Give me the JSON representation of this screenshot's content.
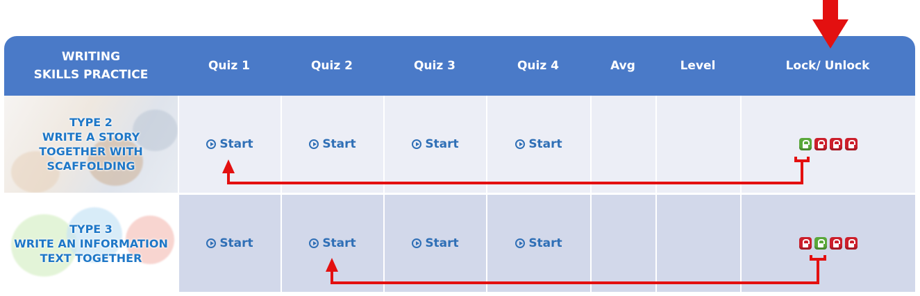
{
  "header": {
    "title_line1": "WRITING",
    "title_line2": "SKILLS PRACTICE",
    "quiz1": "Quiz 1",
    "quiz2": "Quiz 2",
    "quiz3": "Quiz 3",
    "quiz4": "Quiz 4",
    "avg": "Avg",
    "level": "Level",
    "lock_unlock": "Lock/ Unlock"
  },
  "rows": [
    {
      "title_lines": [
        "TYPE 2",
        "WRITE A STORY",
        "TOGETHER WITH",
        "SCAFFOLDING"
      ],
      "quizzes": [
        "Start",
        "Start",
        "Start",
        "Start"
      ],
      "avg": "",
      "level": "",
      "locks": [
        "unlocked",
        "locked",
        "locked",
        "locked"
      ]
    },
    {
      "title_lines": [
        "TYPE 3",
        "WRITE AN INFORMATION",
        "TEXT TOGETHER"
      ],
      "quizzes": [
        "Start",
        "Start",
        "Start",
        "Start"
      ],
      "avg": "",
      "level": "",
      "locks": [
        "locked",
        "unlocked",
        "locked",
        "locked"
      ]
    }
  ],
  "colors": {
    "header": "#4a7ac8",
    "row1": "#eceef6",
    "row2": "#d2d8ea",
    "link": "#2f6fb6",
    "title": "#1e77c7",
    "lock_red": "#cc1f2b",
    "lock_green": "#5aa83a",
    "annotation": "#e31010"
  },
  "icons": {
    "start": "play-circle-icon",
    "lock": "padlock-icon",
    "annotation": "arrow"
  }
}
